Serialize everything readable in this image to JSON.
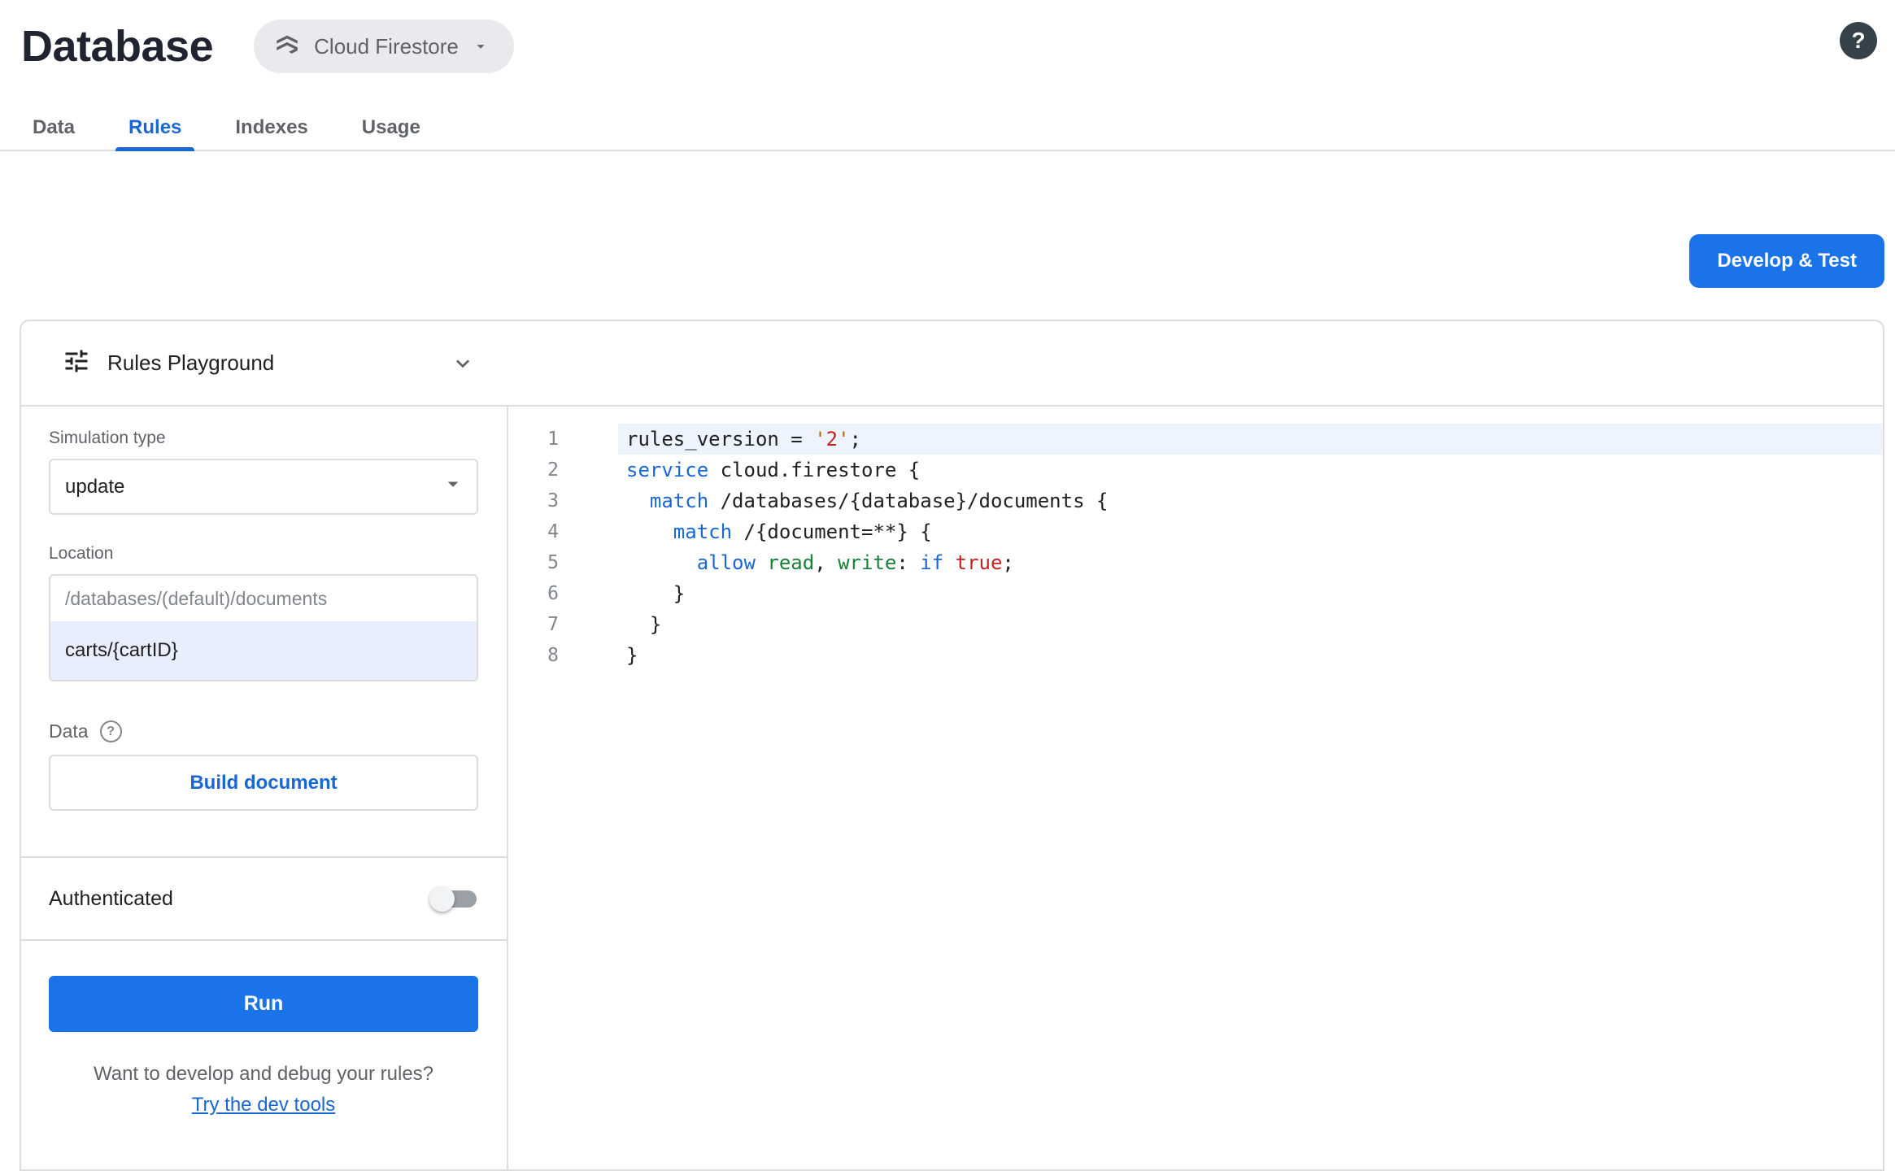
{
  "page": {
    "bg": "#ffffff",
    "accent": "#1a73e8"
  },
  "header": {
    "title": "Database",
    "product_selector": {
      "label": "Cloud Firestore"
    },
    "help_glyph": "?"
  },
  "tabs": [
    {
      "label": "Data",
      "active": false
    },
    {
      "label": "Rules",
      "active": true
    },
    {
      "label": "Indexes",
      "active": false
    },
    {
      "label": "Usage",
      "active": false
    }
  ],
  "actions": {
    "develop_test": "Develop & Test"
  },
  "playground": {
    "title": "Rules Playground",
    "simulation_type": {
      "label": "Simulation type",
      "value": "update"
    },
    "location": {
      "label": "Location",
      "prefix": "/databases/(default)/documents",
      "value": "carts/{cartID}"
    },
    "data_section": {
      "label": "Data",
      "help_glyph": "?",
      "build_button": "Build document"
    },
    "auth": {
      "label": "Authenticated",
      "enabled": false
    },
    "run_button": "Run",
    "dev_tools": {
      "prompt": "Want to develop and debug your rules?",
      "link": "Try the dev tools"
    }
  },
  "editor": {
    "colors": {
      "plain": "#202124",
      "keyword": "#1967d2",
      "perm": "#188038",
      "string": "#c5221f",
      "quote": "#c26401",
      "gutter": "#80868b",
      "highlight": "#eef4fe"
    },
    "lines": [
      {
        "number": 1,
        "highlight": true,
        "tokens": [
          {
            "t": "rules_version = ",
            "c": "plain"
          },
          {
            "t": "'",
            "c": "quote"
          },
          {
            "t": "2",
            "c": "string"
          },
          {
            "t": "'",
            "c": "quote"
          },
          {
            "t": ";",
            "c": "plain"
          }
        ]
      },
      {
        "number": 2,
        "highlight": false,
        "tokens": [
          {
            "t": "service",
            "c": "keyword"
          },
          {
            "t": " cloud.firestore {",
            "c": "plain"
          }
        ]
      },
      {
        "number": 3,
        "highlight": false,
        "tokens": [
          {
            "t": "  ",
            "c": "plain"
          },
          {
            "t": "match",
            "c": "keyword"
          },
          {
            "t": " /databases/{database}/documents {",
            "c": "plain"
          }
        ]
      },
      {
        "number": 4,
        "highlight": false,
        "tokens": [
          {
            "t": "    ",
            "c": "plain"
          },
          {
            "t": "match",
            "c": "keyword"
          },
          {
            "t": " /{document=**} {",
            "c": "plain"
          }
        ]
      },
      {
        "number": 5,
        "highlight": false,
        "tokens": [
          {
            "t": "      ",
            "c": "plain"
          },
          {
            "t": "allow",
            "c": "keyword"
          },
          {
            "t": " ",
            "c": "plain"
          },
          {
            "t": "read",
            "c": "perm"
          },
          {
            "t": ", ",
            "c": "plain"
          },
          {
            "t": "write",
            "c": "perm"
          },
          {
            "t": ": ",
            "c": "plain"
          },
          {
            "t": "if",
            "c": "keyword"
          },
          {
            "t": " ",
            "c": "plain"
          },
          {
            "t": "true",
            "c": "string"
          },
          {
            "t": ";",
            "c": "plain"
          }
        ]
      },
      {
        "number": 6,
        "highlight": false,
        "tokens": [
          {
            "t": "    }",
            "c": "plain"
          }
        ]
      },
      {
        "number": 7,
        "highlight": false,
        "tokens": [
          {
            "t": "  }",
            "c": "plain"
          }
        ]
      },
      {
        "number": 8,
        "highlight": false,
        "tokens": [
          {
            "t": "}",
            "c": "plain"
          }
        ]
      }
    ]
  }
}
